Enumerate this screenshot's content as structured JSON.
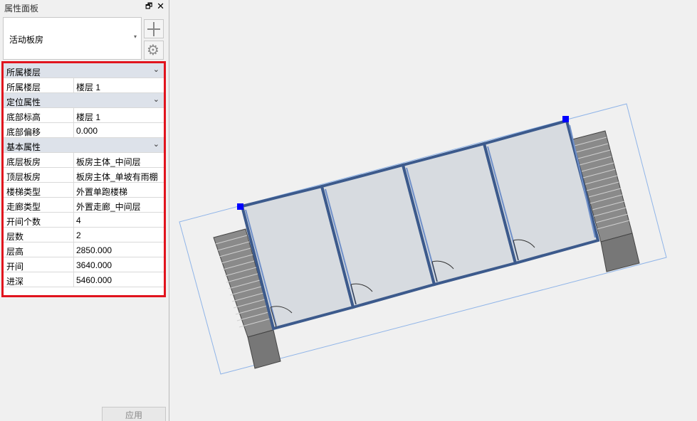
{
  "panel": {
    "title": "属性面板",
    "dock_icon": "restore-icon",
    "close_icon": "close-icon",
    "type_selector": {
      "value": "活动板房"
    },
    "add_button_icon": "plus-icon",
    "settings_button_icon": "gear-icon",
    "groups": [
      {
        "title": "所属楼层",
        "rows": [
          {
            "key": "所属楼层",
            "value": "楼层 1"
          }
        ]
      },
      {
        "title": "定位属性",
        "rows": [
          {
            "key": "底部标高",
            "value": "楼层 1"
          },
          {
            "key": "底部偏移",
            "value": "0.000"
          }
        ]
      },
      {
        "title": "基本属性",
        "rows": [
          {
            "key": "底层板房",
            "value": "板房主体_中间层"
          },
          {
            "key": "顶层板房",
            "value": "板房主体_单坡有雨棚"
          },
          {
            "key": "楼梯类型",
            "value": "外置单跑楼梯"
          },
          {
            "key": "走廊类型",
            "value": "外置走廊_中间层"
          },
          {
            "key": "开间个数",
            "value": "4"
          },
          {
            "key": "层数",
            "value": "2"
          },
          {
            "key": "层高",
            "value": "2850.000"
          },
          {
            "key": "开间",
            "value": "3640.000"
          },
          {
            "key": "进深",
            "value": "5460.000"
          }
        ]
      }
    ],
    "apply_label": "应用"
  },
  "colors": {
    "highlight_border": "#e1141e",
    "group_header": "#dde2ea",
    "wall": "#3c5a8c",
    "room_fill": "#d7dbe0",
    "stair_fill": "#7a7a7a",
    "grip": "#0000ff"
  }
}
